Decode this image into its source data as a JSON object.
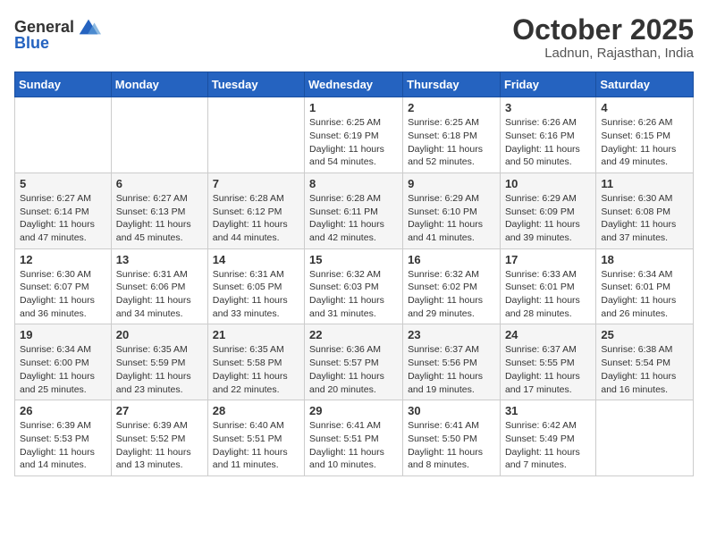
{
  "header": {
    "logo_general": "General",
    "logo_blue": "Blue",
    "month_title": "October 2025",
    "location": "Ladnun, Rajasthan, India"
  },
  "weekdays": [
    "Sunday",
    "Monday",
    "Tuesday",
    "Wednesday",
    "Thursday",
    "Friday",
    "Saturday"
  ],
  "weeks": [
    [
      null,
      null,
      null,
      {
        "day": "1",
        "sunrise": "6:25 AM",
        "sunset": "6:19 PM",
        "daylight": "11 hours and 54 minutes."
      },
      {
        "day": "2",
        "sunrise": "6:25 AM",
        "sunset": "6:18 PM",
        "daylight": "11 hours and 52 minutes."
      },
      {
        "day": "3",
        "sunrise": "6:26 AM",
        "sunset": "6:16 PM",
        "daylight": "11 hours and 50 minutes."
      },
      {
        "day": "4",
        "sunrise": "6:26 AM",
        "sunset": "6:15 PM",
        "daylight": "11 hours and 49 minutes."
      }
    ],
    [
      {
        "day": "5",
        "sunrise": "6:27 AM",
        "sunset": "6:14 PM",
        "daylight": "11 hours and 47 minutes."
      },
      {
        "day": "6",
        "sunrise": "6:27 AM",
        "sunset": "6:13 PM",
        "daylight": "11 hours and 45 minutes."
      },
      {
        "day": "7",
        "sunrise": "6:28 AM",
        "sunset": "6:12 PM",
        "daylight": "11 hours and 44 minutes."
      },
      {
        "day": "8",
        "sunrise": "6:28 AM",
        "sunset": "6:11 PM",
        "daylight": "11 hours and 42 minutes."
      },
      {
        "day": "9",
        "sunrise": "6:29 AM",
        "sunset": "6:10 PM",
        "daylight": "11 hours and 41 minutes."
      },
      {
        "day": "10",
        "sunrise": "6:29 AM",
        "sunset": "6:09 PM",
        "daylight": "11 hours and 39 minutes."
      },
      {
        "day": "11",
        "sunrise": "6:30 AM",
        "sunset": "6:08 PM",
        "daylight": "11 hours and 37 minutes."
      }
    ],
    [
      {
        "day": "12",
        "sunrise": "6:30 AM",
        "sunset": "6:07 PM",
        "daylight": "11 hours and 36 minutes."
      },
      {
        "day": "13",
        "sunrise": "6:31 AM",
        "sunset": "6:06 PM",
        "daylight": "11 hours and 34 minutes."
      },
      {
        "day": "14",
        "sunrise": "6:31 AM",
        "sunset": "6:05 PM",
        "daylight": "11 hours and 33 minutes."
      },
      {
        "day": "15",
        "sunrise": "6:32 AM",
        "sunset": "6:03 PM",
        "daylight": "11 hours and 31 minutes."
      },
      {
        "day": "16",
        "sunrise": "6:32 AM",
        "sunset": "6:02 PM",
        "daylight": "11 hours and 29 minutes."
      },
      {
        "day": "17",
        "sunrise": "6:33 AM",
        "sunset": "6:01 PM",
        "daylight": "11 hours and 28 minutes."
      },
      {
        "day": "18",
        "sunrise": "6:34 AM",
        "sunset": "6:01 PM",
        "daylight": "11 hours and 26 minutes."
      }
    ],
    [
      {
        "day": "19",
        "sunrise": "6:34 AM",
        "sunset": "6:00 PM",
        "daylight": "11 hours and 25 minutes."
      },
      {
        "day": "20",
        "sunrise": "6:35 AM",
        "sunset": "5:59 PM",
        "daylight": "11 hours and 23 minutes."
      },
      {
        "day": "21",
        "sunrise": "6:35 AM",
        "sunset": "5:58 PM",
        "daylight": "11 hours and 22 minutes."
      },
      {
        "day": "22",
        "sunrise": "6:36 AM",
        "sunset": "5:57 PM",
        "daylight": "11 hours and 20 minutes."
      },
      {
        "day": "23",
        "sunrise": "6:37 AM",
        "sunset": "5:56 PM",
        "daylight": "11 hours and 19 minutes."
      },
      {
        "day": "24",
        "sunrise": "6:37 AM",
        "sunset": "5:55 PM",
        "daylight": "11 hours and 17 minutes."
      },
      {
        "day": "25",
        "sunrise": "6:38 AM",
        "sunset": "5:54 PM",
        "daylight": "11 hours and 16 minutes."
      }
    ],
    [
      {
        "day": "26",
        "sunrise": "6:39 AM",
        "sunset": "5:53 PM",
        "daylight": "11 hours and 14 minutes."
      },
      {
        "day": "27",
        "sunrise": "6:39 AM",
        "sunset": "5:52 PM",
        "daylight": "11 hours and 13 minutes."
      },
      {
        "day": "28",
        "sunrise": "6:40 AM",
        "sunset": "5:51 PM",
        "daylight": "11 hours and 11 minutes."
      },
      {
        "day": "29",
        "sunrise": "6:41 AM",
        "sunset": "5:51 PM",
        "daylight": "11 hours and 10 minutes."
      },
      {
        "day": "30",
        "sunrise": "6:41 AM",
        "sunset": "5:50 PM",
        "daylight": "11 hours and 8 minutes."
      },
      {
        "day": "31",
        "sunrise": "6:42 AM",
        "sunset": "5:49 PM",
        "daylight": "11 hours and 7 minutes."
      },
      null
    ]
  ]
}
